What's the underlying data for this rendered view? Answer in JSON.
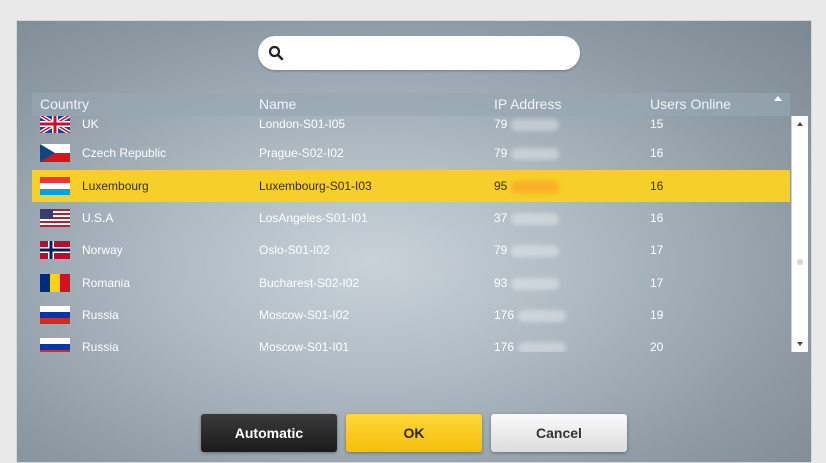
{
  "search": {
    "value": "",
    "placeholder": ""
  },
  "table": {
    "headers": {
      "country": "Country",
      "name": "Name",
      "ip": "IP Address",
      "users": "Users Online"
    },
    "rows": [
      {
        "country": "UK",
        "flag": "uk-flag",
        "name": "London-S01-I05",
        "ip": "79",
        "users": "15"
      },
      {
        "country": "Czech Republic",
        "flag": "czech-flag",
        "name": "Prague-S02-I02",
        "ip": "79",
        "users": "16"
      },
      {
        "country": "Luxembourg",
        "flag": "luxembourg-flag",
        "name": "Luxembourg-S01-I03",
        "ip": "95",
        "users": "16",
        "selected": true
      },
      {
        "country": "U.S.A",
        "flag": "usa-flag",
        "name": "LosAngeles-S01-I01",
        "ip": "37",
        "users": "16"
      },
      {
        "country": "Norway",
        "flag": "norway-flag",
        "name": "Oslo-S01-I02",
        "ip": "79",
        "users": "17"
      },
      {
        "country": "Romania",
        "flag": "romania-flag",
        "name": "Bucharest-S02-I02",
        "ip": "93",
        "users": "17"
      },
      {
        "country": "Russia",
        "flag": "russia-flag",
        "name": "Moscow-S01-I02",
        "ip": "176",
        "users": "19"
      },
      {
        "country": "Russia",
        "flag": "russia-flag",
        "name": "Moscow-S01-I01",
        "ip": "176",
        "users": "20"
      }
    ]
  },
  "buttons": {
    "automatic": "Automatic",
    "ok": "OK",
    "cancel": "Cancel"
  },
  "colors": {
    "selected_row": "#f6cf2a",
    "ok_button": "#f3bf0c",
    "automatic_button": "#1b1b1b"
  }
}
